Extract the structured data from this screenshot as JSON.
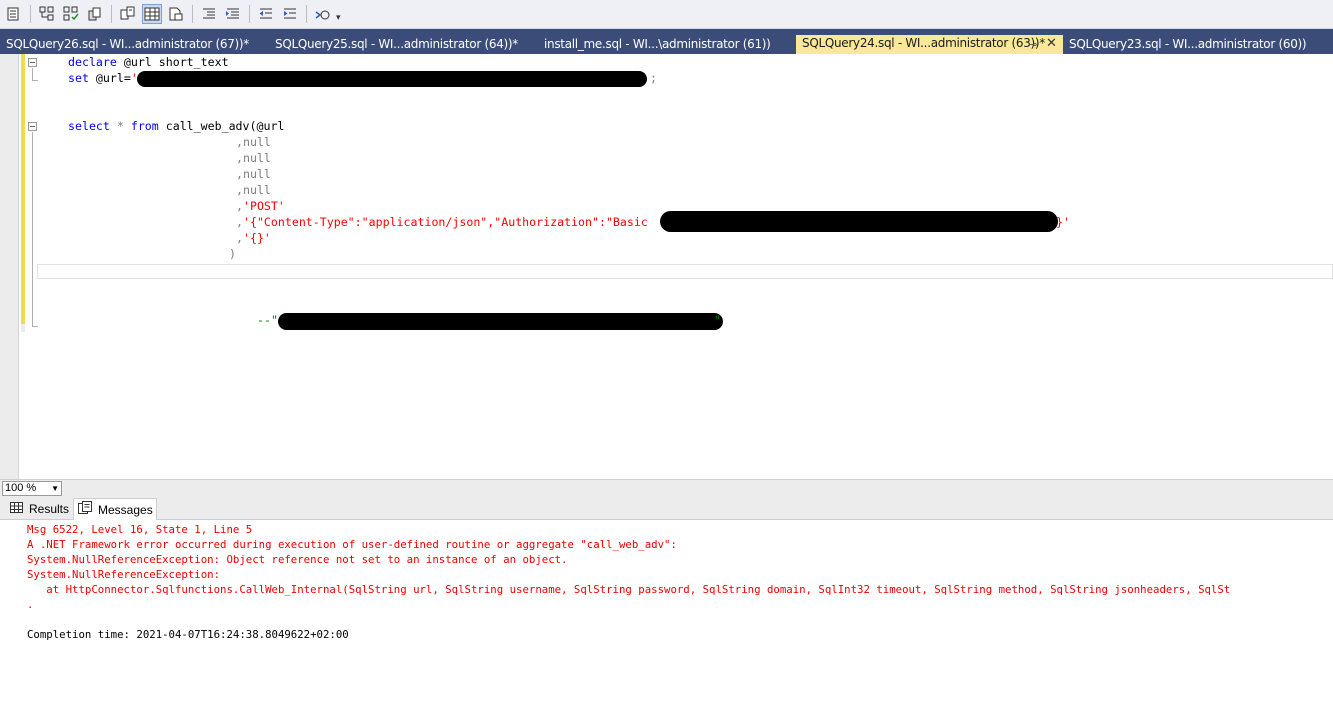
{
  "toolbar": {
    "buttons": [
      "query-options-icon",
      "comment-icon",
      "uncomment-icon",
      "parse-icon",
      "display-plan-icon",
      "results-to-grid-icon",
      "results-to-file-icon",
      "decrease-indent-icon",
      "increase-indent-icon",
      "outdent-icon",
      "indent-icon",
      "specify-values-icon"
    ]
  },
  "tabs": [
    {
      "label": "SQLQuery26.sql - WI...administrator (67))*",
      "active": false
    },
    {
      "label": "SQLQuery25.sql - WI...administrator (64))*",
      "active": false
    },
    {
      "label": "install_me.sql - WI...\\administrator (61))",
      "active": false
    },
    {
      "label": "SQLQuery24.sql - WI...administrator (63))*",
      "active": true
    },
    {
      "label": "SQLQuery23.sql - WI...administrator (60))",
      "active": false
    }
  ],
  "tab_pin_glyph": "⊸",
  "tab_close_glyph": "✕",
  "editor": {
    "line1_kw": "declare",
    "line1_rest": " @url short_text",
    "line2_kw": "set",
    "line2_var": " @url=",
    "line2_str": "'",
    "line2_end": ";",
    "line3_kw1": "select",
    "line3_star": " * ",
    "line3_kw2": "from",
    "line3_rest": " call_web_adv(@url",
    "null_lines": [
      ",null",
      ",null",
      ",null",
      ",null"
    ],
    "post_comma": ",",
    "post_str": "'POST'",
    "headers_comma": ",",
    "headers_str": "'{\"Content-Type\":\"application/json\",\"Authorization\":\"Basic ",
    "headers_end": "}'",
    "body_comma": ",",
    "body_str": "'{}'",
    "close_paren": ")",
    "comment_start": "--\"",
    "comment_end": "\""
  },
  "zoom": {
    "value": "100 %"
  },
  "result_tabs": {
    "results": "Results",
    "messages": "Messages"
  },
  "messages": {
    "line1": "Msg 6522, Level 16, State 1, Line 5",
    "line2": "A .NET Framework error occurred during execution of user-defined routine or aggregate \"call_web_adv\":",
    "line3": "System.NullReferenceException: Object reference not set to an instance of an object.",
    "line4": "System.NullReferenceException:",
    "line5": "   at HttpConnector.Sqlfunctions.CallWeb_Internal(SqlString url, SqlString username, SqlString password, SqlString domain, SqlInt32 timeout, SqlString method, SqlString jsonheaders, SqlSt",
    "line6": ".",
    "completion": "Completion time: 2021-04-07T16:24:38.8049622+02:00"
  },
  "colors": {
    "tab_strip": "#3c4c78",
    "active_tab": "#f9e79a",
    "keyword": "#0000ff",
    "string": "#ff0000",
    "error": "#ee0000",
    "change_bar": "#f2dc4b"
  }
}
